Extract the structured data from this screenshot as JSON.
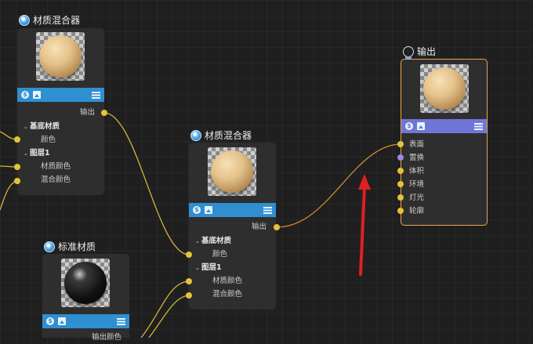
{
  "nodes": {
    "mixer_top": {
      "title": "材质混合器",
      "output": "输出",
      "group1": "基底材质",
      "group1_item": "颜色",
      "group2": "图层1",
      "group2_items": [
        "材质颜色",
        "混合颜色"
      ]
    },
    "mixer_center": {
      "title": "材质混合器",
      "output": "输出",
      "group1": "基底材质",
      "group1_item": "颜色",
      "group2": "图层1",
      "group2_items": [
        "材质颜色",
        "混合颜色"
      ]
    },
    "standard": {
      "title": "标准材质",
      "output": "输出颜色"
    },
    "output": {
      "title": "输出",
      "inputs": [
        "表面",
        "置换",
        "体积",
        "环境",
        "灯光",
        "轮廓"
      ]
    }
  },
  "colors": {
    "wire": "#d7b43a",
    "toolbar_blue": "#2f8fd1",
    "toolbar_purple": "#6f76d6",
    "selected_border": "#e8a64a",
    "annotation_arrow": "#e02020"
  },
  "icons": [
    "material-node-icon",
    "output-node-icon",
    "currency-icon",
    "image-icon",
    "menu-icon"
  ]
}
